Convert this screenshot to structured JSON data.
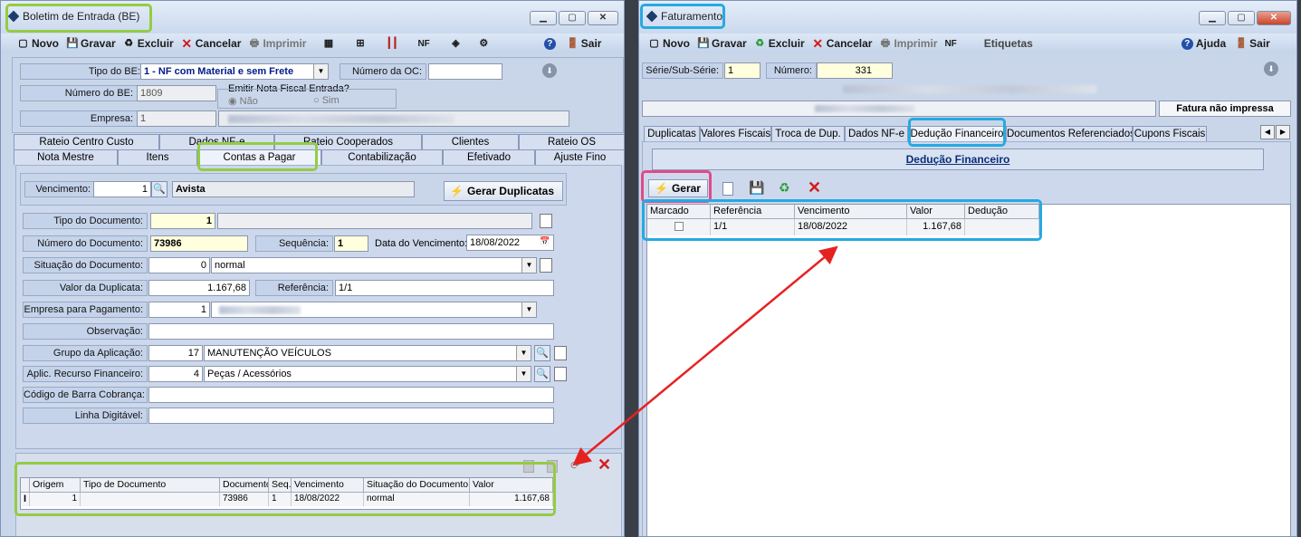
{
  "left_window": {
    "title": "Boletim de Entrada (BE)",
    "toolbar": {
      "novo": "Novo",
      "gravar": "Gravar",
      "excluir": "Excluir",
      "cancelar": "Cancelar",
      "imprimir": "Imprimir",
      "nf": "NF",
      "sair": "Sair"
    },
    "tipo_be": {
      "label": "Tipo do BE:",
      "value": "1 - NF com Material e sem Frete"
    },
    "numero_oc": {
      "label": "Número da OC:",
      "value": ""
    },
    "numero_be": {
      "label": "Número do BE:",
      "value": "1809"
    },
    "emitir_nf": {
      "label": "Emitir Nota Fiscal Entrada?",
      "nao": "Não",
      "sim": "Sim"
    },
    "empresa": {
      "label": "Empresa:",
      "value": "1"
    },
    "tabs_row1": [
      "Rateio Centro Custo",
      "Dados NF-e",
      "Rateio Cooperados",
      "Clientes",
      "Rateio OS"
    ],
    "tabs_row2": [
      "Nota Mestre",
      "Itens",
      "Contas a Pagar",
      "Contabilização",
      "Efetivado",
      "Ajuste Fino"
    ],
    "vencimento": {
      "label": "Vencimento:",
      "code": "1",
      "value": "Avista"
    },
    "gerar_duplicatas": "Gerar Duplicatas",
    "fields": {
      "tipo_documento": {
        "label": "Tipo do Documento:",
        "value": "1"
      },
      "numero_documento": {
        "label": "Número do Documento:",
        "value": "73986"
      },
      "sequencia": {
        "label": "Sequência:",
        "value": "1"
      },
      "data_vencimento": {
        "label": "Data do Vencimento:",
        "value": "18/08/2022"
      },
      "situacao": {
        "label": "Situação do Documento:",
        "code": "0",
        "value": "normal"
      },
      "valor_duplicata": {
        "label": "Valor da Duplicata:",
        "value": "1.167,68"
      },
      "referencia": {
        "label": "Referência:",
        "value": "1/1"
      },
      "empresa_pagamento": {
        "label": "Empresa para Pagamento:",
        "code": "1"
      },
      "observacao": {
        "label": "Observação:",
        "value": ""
      },
      "grupo_aplicacao": {
        "label": "Grupo da Aplicação:",
        "code": "17",
        "value": "MANUTENÇÃO VEÍCULOS"
      },
      "aplic_recurso": {
        "label": "Aplic. Recurso Financeiro:",
        "code": "4",
        "value": "Peças / Acessórios"
      },
      "codigo_barra": {
        "label": "Código de Barra Cobrança:",
        "value": ""
      },
      "linha_digitavel": {
        "label": "Linha Digitável:",
        "value": ""
      }
    },
    "grid": {
      "headers": [
        "Origem",
        "Tipo de Documento",
        "Documento",
        "Seq.",
        "Vencimento",
        "Situação do Documento",
        "Valor"
      ],
      "row": [
        "1",
        "",
        "73986",
        "1",
        "18/08/2022",
        "normal",
        "1.167,68"
      ]
    }
  },
  "right_window": {
    "title": "Faturamento",
    "toolbar": {
      "novo": "Novo",
      "gravar": "Gravar",
      "excluir": "Excluir",
      "cancelar": "Cancelar",
      "imprimir": "Imprimir",
      "nf": "NF",
      "etiquetas": "Etiquetas",
      "ajuda": "Ajuda",
      "sair": "Sair"
    },
    "serie": {
      "label": "Série/Sub-Série:",
      "value": "1"
    },
    "numero": {
      "label": "Número:",
      "value": "331"
    },
    "status": "Fatura não impressa",
    "tabs": [
      "Duplicatas",
      "Valores Fiscais",
      "Troca de Dup.",
      "Dados NF-e",
      "Dedução Financeiro",
      "Documentos Referenciados",
      "Cupons Fiscais"
    ],
    "section_title": "Dedução Financeiro",
    "gerar": "Gerar",
    "grid": {
      "headers": [
        "Marcado",
        "Referência",
        "Vencimento",
        "Valor",
        "Dedução"
      ],
      "row": [
        "",
        "1/1",
        "18/08/2022",
        "1.167,68",
        ""
      ]
    }
  },
  "colors": {
    "highlight_green": "#94cc44",
    "highlight_blue": "#27a9e1",
    "highlight_pink": "#e04a88",
    "arrow": "#e52222"
  }
}
